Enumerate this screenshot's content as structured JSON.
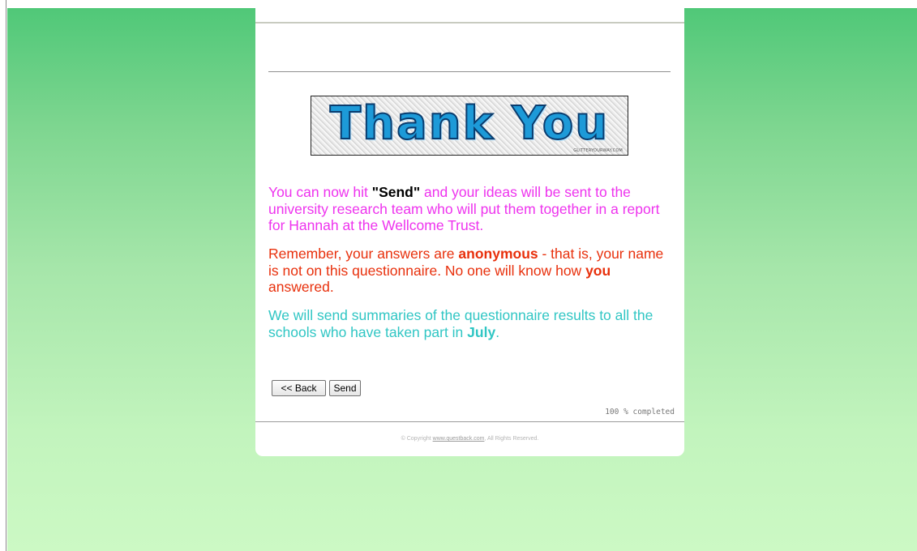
{
  "page": {
    "background_top_color": "#50c878",
    "background_bottom_color": "#ccf9c4"
  },
  "banner": {
    "text": "Thank You",
    "credit": "GLITTERYOURWAY.COM",
    "text_color": "#1d9ad8"
  },
  "message": {
    "p1_before": "You can now hit ",
    "p1_send": "\"Send\"",
    "p1_after": " and your ideas will be sent to the university research team who will put them together in a report for Hannah at the Wellcome Trust.",
    "p1_color": "#ee33ee",
    "p2_before": "Remember, your answers are ",
    "p2_anonymous": "anonymous",
    "p2_middle": " - that is, your name is not on this questionnaire. No one will know how ",
    "p2_you": "you",
    "p2_after": " answered.",
    "p2_color": "#e8300c",
    "p3_before": "We will send summaries of the questionnaire results to all the schools who have taken part in ",
    "p3_july": "July",
    "p3_after": ".",
    "p3_color": "#30c6c4"
  },
  "buttons": {
    "back_label": "<< Back",
    "send_label": "Send"
  },
  "progress": {
    "text": "100 % completed",
    "percent": 100
  },
  "footer": {
    "prefix": "© Copyright ",
    "link": "www.questback.com",
    "suffix": ", All Rights Reserved."
  }
}
